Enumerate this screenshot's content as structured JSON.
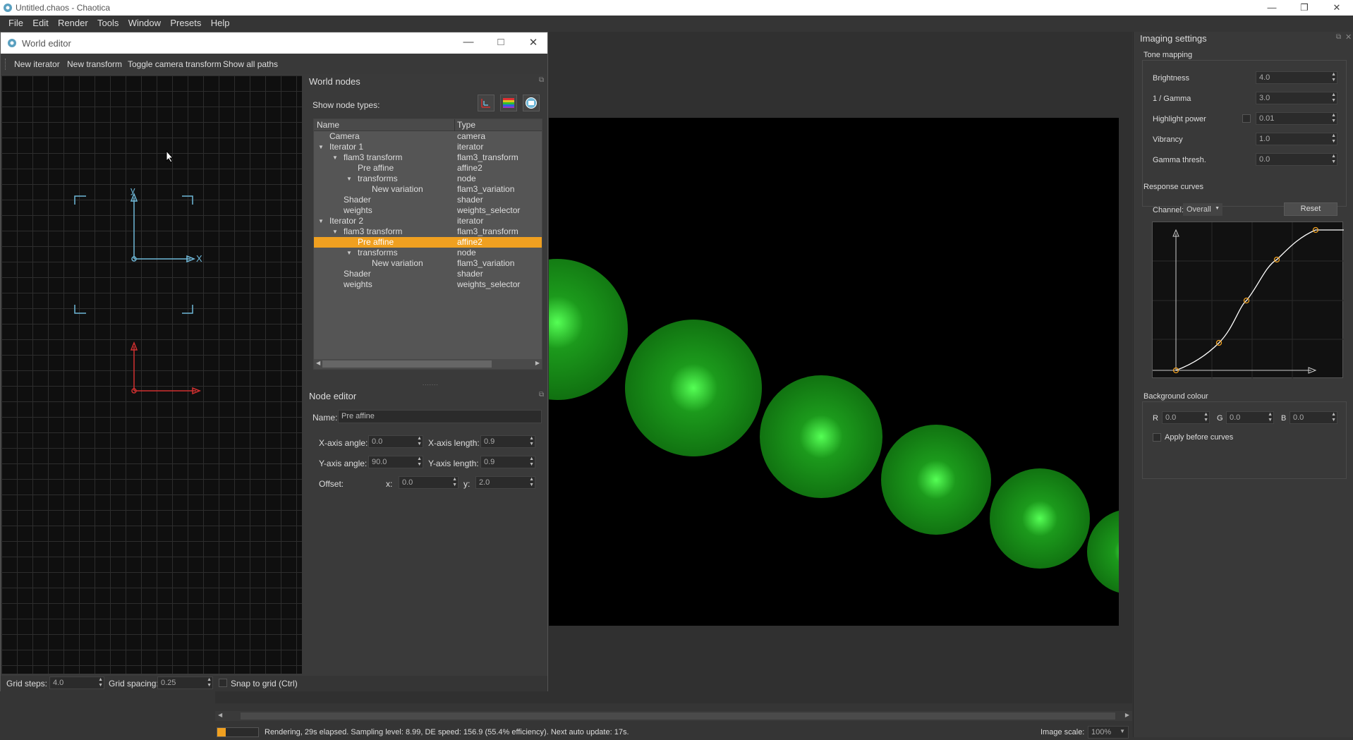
{
  "app": {
    "title": "Untitled.chaos - Chaotica"
  },
  "menu": [
    "File",
    "Edit",
    "Render",
    "Tools",
    "Window",
    "Presets",
    "Help"
  ],
  "world_editor": {
    "title": "World editor",
    "toolbar": [
      "New iterator",
      "New transform",
      "Toggle camera transform",
      "Show all paths"
    ],
    "axis_labels": {
      "x": "X",
      "y": "y"
    },
    "bottom": {
      "grid_steps_label": "Grid steps:",
      "grid_steps_value": "4.0",
      "grid_spacing_label": "Grid spacing:",
      "grid_spacing_value": "0.25",
      "snap_label": "Snap to grid (Ctrl)"
    }
  },
  "world_nodes": {
    "title": "World nodes",
    "show_types_label": "Show node types:",
    "columns": {
      "name": "Name",
      "type": "Type"
    },
    "rows": [
      {
        "name": "Camera",
        "type": "camera",
        "indent": 0,
        "twisty": false
      },
      {
        "name": "Iterator 1",
        "type": "iterator",
        "indent": 0,
        "twisty": true
      },
      {
        "name": "flam3 transform",
        "type": "flam3_transform",
        "indent": 1,
        "twisty": true
      },
      {
        "name": "Pre affine",
        "type": "affine2",
        "indent": 2,
        "twisty": false
      },
      {
        "name": "transforms",
        "type": "node",
        "indent": 2,
        "twisty": true
      },
      {
        "name": "New variation",
        "type": "flam3_variation",
        "indent": 3,
        "twisty": false
      },
      {
        "name": "Shader",
        "type": "shader",
        "indent": 1,
        "twisty": false
      },
      {
        "name": "weights",
        "type": "weights_selector",
        "indent": 1,
        "twisty": false
      },
      {
        "name": "Iterator 2",
        "type": "iterator",
        "indent": 0,
        "twisty": true
      },
      {
        "name": "flam3 transform",
        "type": "flam3_transform",
        "indent": 1,
        "twisty": true
      },
      {
        "name": "Pre affine",
        "type": "affine2",
        "indent": 2,
        "twisty": false,
        "selected": true
      },
      {
        "name": "transforms",
        "type": "node",
        "indent": 2,
        "twisty": true
      },
      {
        "name": "New variation",
        "type": "flam3_variation",
        "indent": 3,
        "twisty": false
      },
      {
        "name": "Shader",
        "type": "shader",
        "indent": 1,
        "twisty": false
      },
      {
        "name": "weights",
        "type": "weights_selector",
        "indent": 1,
        "twisty": false
      }
    ]
  },
  "node_editor": {
    "title": "Node editor",
    "name_label": "Name:",
    "name_value": "Pre affine",
    "x_axis_angle_label": "X-axis angle:",
    "x_axis_angle": "0.0",
    "x_axis_length_label": "X-axis length:",
    "x_axis_length": "0.9",
    "y_axis_angle_label": "Y-axis angle:",
    "y_axis_angle": "90.0",
    "y_axis_length_label": "Y-axis length:",
    "y_axis_length": "0.9",
    "offset_label": "Offset:",
    "x_label": "x:",
    "x_value": "0.0",
    "y_label": "y:",
    "y_value": "2.0"
  },
  "imaging": {
    "title": "Imaging settings",
    "tone_mapping": "Tone mapping",
    "brightness_label": "Brightness",
    "brightness": "4.0",
    "gamma_label": "1 / Gamma",
    "gamma": "3.0",
    "highlight_label": "Highlight power",
    "highlight": "0.01",
    "vibrancy_label": "Vibrancy",
    "vibrancy": "1.0",
    "gamma_thresh_label": "Gamma thresh.",
    "gamma_thresh": "0.0",
    "response_curves": "Response curves",
    "channel_label": "Channel:",
    "channel_value": "Overall",
    "reset_label": "Reset",
    "background_colour": "Background colour",
    "r_label": "R",
    "r": "0.0",
    "g_label": "G",
    "g": "0.0",
    "b_label": "B",
    "b": "0.0",
    "apply_before_label": "Apply before curves"
  },
  "status": {
    "text": "Rendering, 29s elapsed. Sampling level: 8.99, DE speed: 156.9 (55.4% efficiency). Next auto update: 17s.",
    "image_scale_label": "Image scale:",
    "image_scale": "100%"
  },
  "colors": {
    "accent": "#f0a020",
    "ball": "#2a9a2a",
    "camera_axis": "#6fb8d8",
    "transform_axis": "#d03030"
  }
}
